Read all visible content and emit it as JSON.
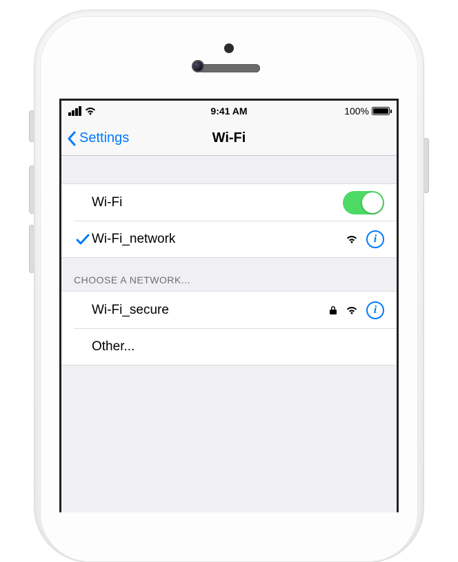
{
  "statusbar": {
    "time": "9:41 AM",
    "battery_text": "100%"
  },
  "nav": {
    "back_label": "Settings",
    "title": "Wi-Fi"
  },
  "wifi_toggle": {
    "label": "Wi-Fi",
    "on": true
  },
  "connected": {
    "name": "Wi-Fi_network",
    "secured": false
  },
  "choose_header": "CHOOSE A NETWORK...",
  "networks": [
    {
      "name": "Wi-Fi_secure",
      "secured": true
    }
  ],
  "other_label": "Other..."
}
